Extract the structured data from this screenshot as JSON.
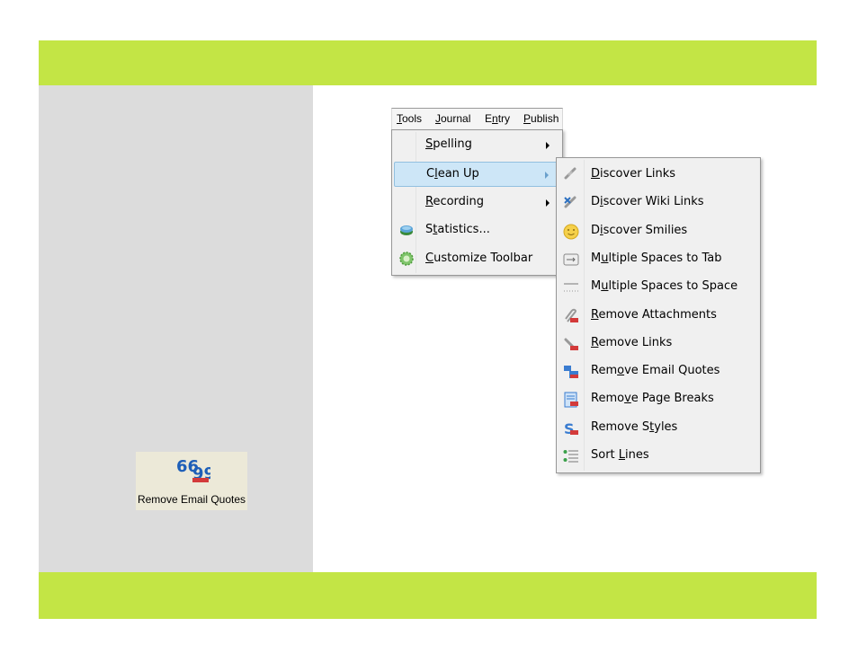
{
  "toolbar_button": {
    "label": "Remove Email Quotes",
    "icon": "quotes-icon"
  },
  "menubar": {
    "items": [
      {
        "label": "Tools",
        "accel": "T"
      },
      {
        "label": "Journal",
        "accel": "J"
      },
      {
        "label": "Entry",
        "accel": "n"
      },
      {
        "label": "Publish",
        "accel": "P"
      }
    ]
  },
  "tools_menu": {
    "items": [
      {
        "label": "Spelling",
        "has_submenu": true,
        "icon": ""
      },
      {
        "label": "Clean Up",
        "has_submenu": true,
        "highlighted": true,
        "icon": ""
      },
      {
        "label": "Recording",
        "has_submenu": true,
        "icon": ""
      },
      {
        "label": "Statistics...",
        "icon": "database-icon"
      },
      {
        "label": "Customize Toolbar",
        "icon": "gear-icon"
      }
    ]
  },
  "cleanup_submenu": {
    "items": [
      {
        "label": "Discover Links",
        "icon": "link-icon"
      },
      {
        "label": "Discover Wiki Links",
        "icon": "wiki-link-icon"
      },
      {
        "label": "Discover Smilies",
        "icon": "smiley-icon"
      },
      {
        "label": "Multiple Spaces to Tab",
        "icon": "tab-icon"
      },
      {
        "label": "Multiple Spaces to Space",
        "icon": "spaces-icon"
      },
      {
        "label": "Remove Attachments",
        "icon": "paperclip-icon"
      },
      {
        "label": "Remove Links",
        "icon": "remove-link-icon"
      },
      {
        "label": "Remove Email Quotes",
        "icon": "quotes-icon"
      },
      {
        "label": "Remove Page Breaks",
        "icon": "page-break-icon"
      },
      {
        "label": "Remove Styles",
        "icon": "remove-styles-icon"
      },
      {
        "label": "Sort Lines",
        "icon": "sort-lines-icon"
      }
    ]
  },
  "colors": {
    "band": "#c3e545",
    "panel": "#dcdcdc",
    "highlight": "#cde6f7"
  }
}
